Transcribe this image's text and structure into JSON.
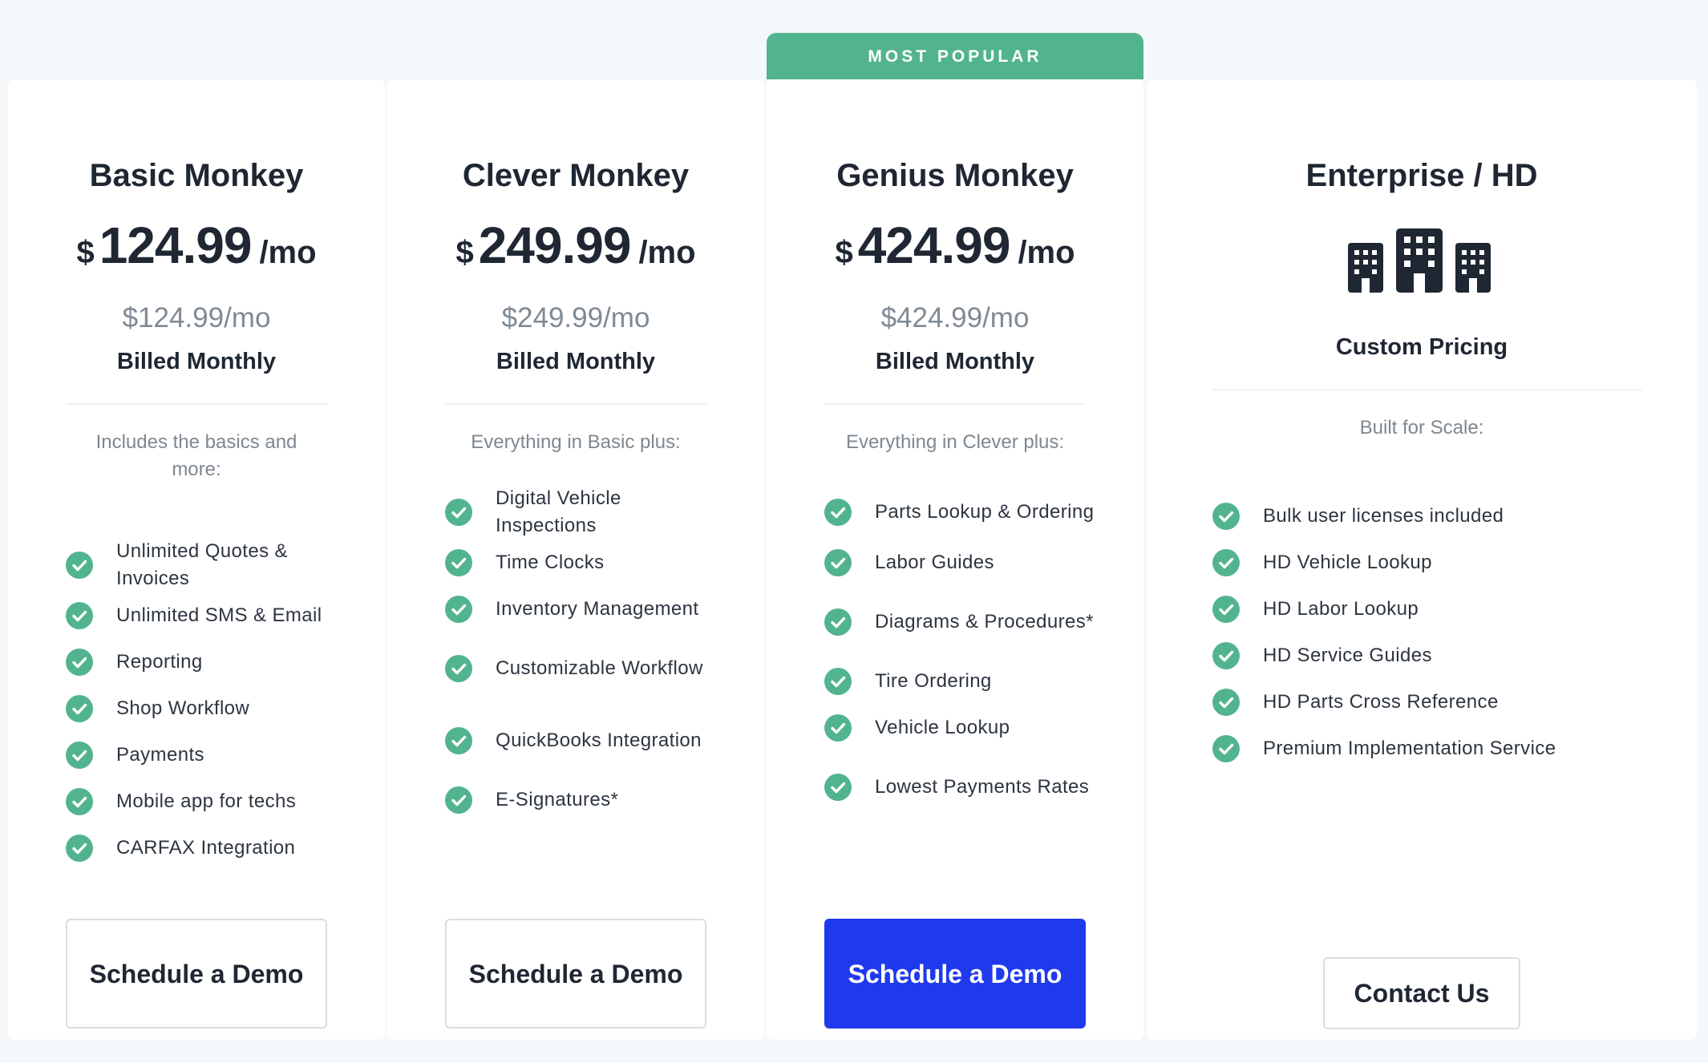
{
  "banner": "MOST POPULAR",
  "plans": [
    {
      "name": "Basic Monkey",
      "currency": "$",
      "amount": "124.99",
      "per": "/mo",
      "sub_price": "$124.99/mo",
      "billing": "Billed Monthly",
      "intro": "Includes the basics and more:",
      "features": [
        "Unlimited Quotes & Invoices",
        "Unlimited SMS & Email",
        "Reporting",
        "Shop Workflow",
        "Payments",
        "Mobile app for techs",
        "CARFAX Integration"
      ],
      "cta": "Schedule a Demo"
    },
    {
      "name": "Clever Monkey",
      "currency": "$",
      "amount": "249.99",
      "per": "/mo",
      "sub_price": "$249.99/mo",
      "billing": "Billed Monthly",
      "intro": "Everything in Basic plus:",
      "features": [
        "Digital Vehicle Inspections",
        "Time Clocks",
        "Inventory Management",
        "Customizable Workflow",
        "QuickBooks Integration",
        "E-Signatures*"
      ],
      "cta": "Schedule a Demo"
    },
    {
      "name": "Genius Monkey",
      "currency": "$",
      "amount": "424.99",
      "per": "/mo",
      "sub_price": "$424.99/mo",
      "billing": "Billed Monthly",
      "intro": "Everything in Clever plus:",
      "features": [
        "Parts Lookup & Ordering",
        "Labor Guides",
        "Diagrams & Procedures*",
        "Tire Ordering",
        "Vehicle Lookup",
        "Lowest Payments Rates"
      ],
      "cta": "Schedule a Demo"
    },
    {
      "name": "Enterprise / HD",
      "pricing_label": "Custom Pricing",
      "icon": "buildings-icon",
      "intro": "Built for Scale:",
      "features": [
        "Bulk user licenses included",
        "HD Vehicle Lookup",
        "HD Labor Lookup",
        "HD Service Guides",
        "HD Parts Cross Reference",
        "Premium Implementation Service"
      ],
      "cta": "Contact Us"
    }
  ],
  "colors": {
    "accent_green": "#52b48f",
    "primary_blue": "#1f3aec",
    "text_dark": "#1f2733",
    "text_muted": "#7e8891"
  }
}
